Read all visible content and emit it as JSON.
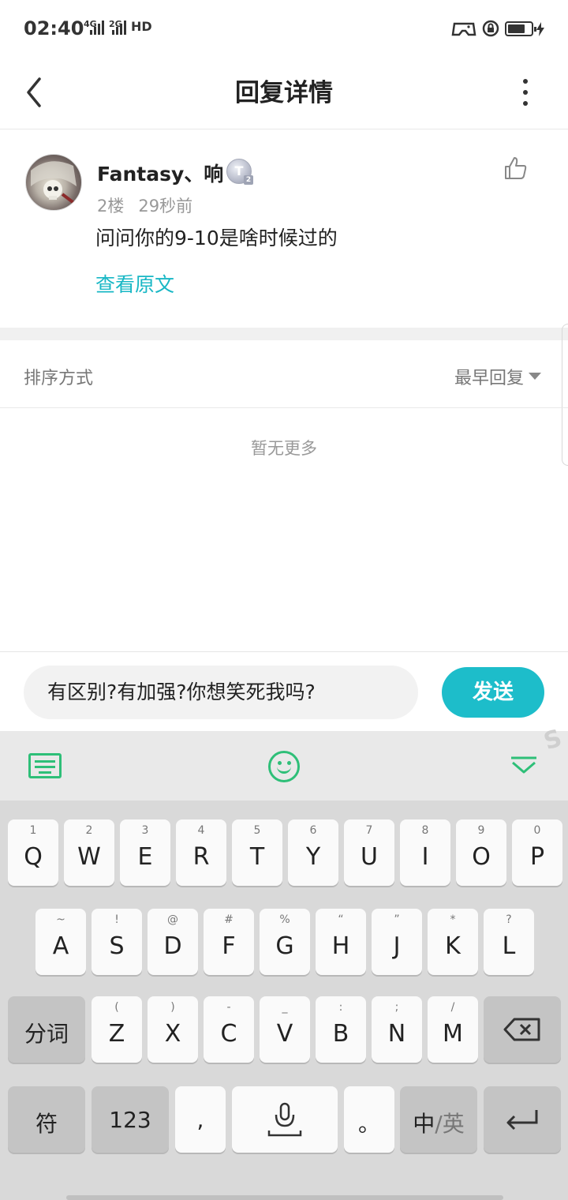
{
  "status_bar": {
    "time": "02:40",
    "network_1": "4G",
    "network_2": "2G",
    "hd": "HD",
    "battery_level": 0.75
  },
  "header": {
    "title": "回复详情"
  },
  "comment": {
    "username": "Fantasy、响",
    "level_badge": "T",
    "level_sub": "2",
    "floor": "2楼",
    "time": "29秒前",
    "text": "问问你的9-10是啥时候过的",
    "view_original": "查看原文"
  },
  "sort": {
    "label": "排序方式",
    "value": "最早回复"
  },
  "empty_text": "暂无更多",
  "reply_bar": {
    "input_value": "有区别?有加强?你想笑死我吗?",
    "send_label": "发送"
  },
  "keyboard": {
    "row1": [
      {
        "sub": "1",
        "key": "Q"
      },
      {
        "sub": "2",
        "key": "W"
      },
      {
        "sub": "3",
        "key": "E"
      },
      {
        "sub": "4",
        "key": "R"
      },
      {
        "sub": "5",
        "key": "T"
      },
      {
        "sub": "6",
        "key": "Y"
      },
      {
        "sub": "7",
        "key": "U"
      },
      {
        "sub": "8",
        "key": "I"
      },
      {
        "sub": "9",
        "key": "O"
      },
      {
        "sub": "0",
        "key": "P"
      }
    ],
    "row2": [
      {
        "sub": "~",
        "key": "A"
      },
      {
        "sub": "!",
        "key": "S"
      },
      {
        "sub": "@",
        "key": "D"
      },
      {
        "sub": "#",
        "key": "F"
      },
      {
        "sub": "%",
        "key": "G"
      },
      {
        "sub": "“",
        "key": "H"
      },
      {
        "sub": "”",
        "key": "J"
      },
      {
        "sub": "*",
        "key": "K"
      },
      {
        "sub": "?",
        "key": "L"
      }
    ],
    "row3": [
      {
        "sub": "(",
        "key": "Z"
      },
      {
        "sub": ")",
        "key": "X"
      },
      {
        "sub": "-",
        "key": "C"
      },
      {
        "sub": "_",
        "key": "V"
      },
      {
        "sub": ":",
        "key": "B"
      },
      {
        "sub": ";",
        "key": "N"
      },
      {
        "sub": "/",
        "key": "M"
      }
    ],
    "segment_key": "分词",
    "symbol_key": "符",
    "number_key": "123",
    "comma_key": ",",
    "period_key": "。",
    "lang_key_cn": "中",
    "lang_key_sep": "/英"
  }
}
